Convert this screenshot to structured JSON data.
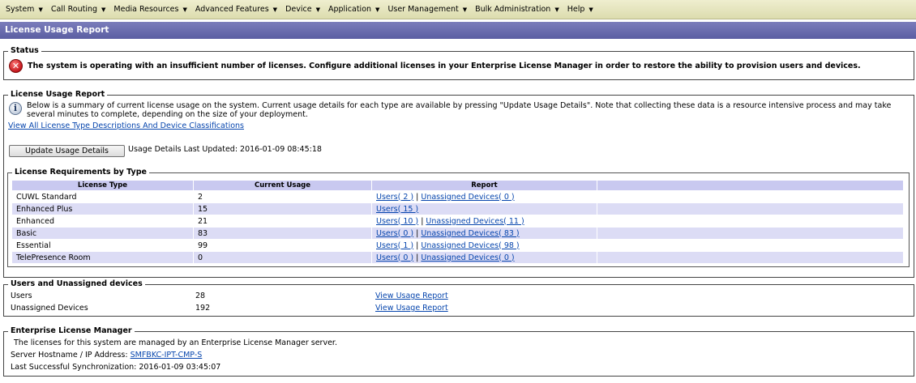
{
  "menu": {
    "items": [
      {
        "label": "System"
      },
      {
        "label": "Call Routing"
      },
      {
        "label": "Media Resources"
      },
      {
        "label": "Advanced Features"
      },
      {
        "label": "Device"
      },
      {
        "label": "Application"
      },
      {
        "label": "User Management"
      },
      {
        "label": "Bulk Administration"
      },
      {
        "label": "Help"
      }
    ],
    "caret": "▼"
  },
  "page_title": "License Usage Report",
  "status": {
    "legend": "Status",
    "icon": "error-icon",
    "icon_glyph": "✕",
    "message": "The system is operating with an insufficient number of licenses. Configure additional licenses in your Enterprise License Manager in order to restore the ability to provision users and devices."
  },
  "report": {
    "legend": "License Usage Report",
    "info_glyph": "i",
    "description": "Below is a summary of current license usage on the system. Current usage details for each type are available by pressing \"Update Usage Details\". Note that collecting these data is a resource intensive process and may take several minutes to complete, depending on the size of your deployment.",
    "view_all_link": "View All License Type Descriptions And Device Classifications",
    "update_button": "Update Usage Details",
    "last_updated": "Usage Details Last Updated: 2016-01-09 08:45:18",
    "requirements": {
      "legend": "License Requirements by Type",
      "columns": [
        "License Type",
        "Current Usage",
        "Report",
        ""
      ],
      "rows": [
        {
          "type": "CUWL Standard",
          "usage": "2",
          "users": "Users( 2 )",
          "sep": "|",
          "unassigned": "Unassigned Devices( 0 )"
        },
        {
          "type": "Enhanced Plus",
          "usage": "15",
          "users": "Users( 15 )",
          "sep": "",
          "unassigned": ""
        },
        {
          "type": "Enhanced",
          "usage": "21",
          "users": "Users( 10 )",
          "sep": "|",
          "unassigned": "Unassigned Devices( 11 )"
        },
        {
          "type": "Basic",
          "usage": "83",
          "users": "Users( 0 )",
          "sep": "|",
          "unassigned": "Unassigned Devices( 83 )"
        },
        {
          "type": "Essential",
          "usage": "99",
          "users": "Users( 1 )",
          "sep": "|",
          "unassigned": "Unassigned Devices( 98 )"
        },
        {
          "type": "TelePresence Room",
          "usage": "0",
          "users": "Users( 0 )",
          "sep": "|",
          "unassigned": "Unassigned Devices( 0 )"
        }
      ]
    }
  },
  "users_unassigned": {
    "legend": "Users and Unassigned devices",
    "rows": [
      {
        "label": "Users",
        "value": "28",
        "link": "View Usage Report"
      },
      {
        "label": "Unassigned Devices",
        "value": "192",
        "link": "View Usage Report"
      }
    ]
  },
  "elm": {
    "legend": "Enterprise License Manager",
    "managed_text": "The licenses for this system are managed by an Enterprise License Manager server.",
    "hostname_label": "Server Hostname / IP Address:",
    "hostname_link": "SMFBKC-IPT-CMP-S",
    "last_sync": "Last Successful Synchronization: 2016-01-09 03:45:07"
  }
}
